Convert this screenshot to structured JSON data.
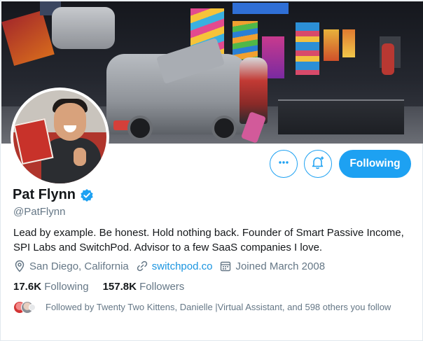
{
  "profile": {
    "name": "Pat Flynn",
    "handle": "@PatFlynn",
    "bio": "Lead by example. Be honest. Hold nothing back. Founder of Smart Passive Income, SPI Labs and SwitchPod. Advisor to a few SaaS companies I love.",
    "location": "San Diego, California",
    "website": "switchpod.co",
    "joined": "Joined March 2008",
    "verified": true
  },
  "actions": {
    "more_icon": "more-horizontal-icon",
    "notify_icon": "bell-plus-icon",
    "follow_label": "Following"
  },
  "stats": {
    "following_count": "17.6K",
    "following_label": "Following",
    "followers_count": "157.8K",
    "followers_label": "Followers"
  },
  "followed_by": {
    "text": "Followed by Twenty Two Kittens, Danielle |Virtual Assistant, and 598 others you follow"
  },
  "colors": {
    "accent": "#1da1f2",
    "link": "#1b95e0",
    "secondary_text": "#657786",
    "primary_text": "#14171a"
  }
}
